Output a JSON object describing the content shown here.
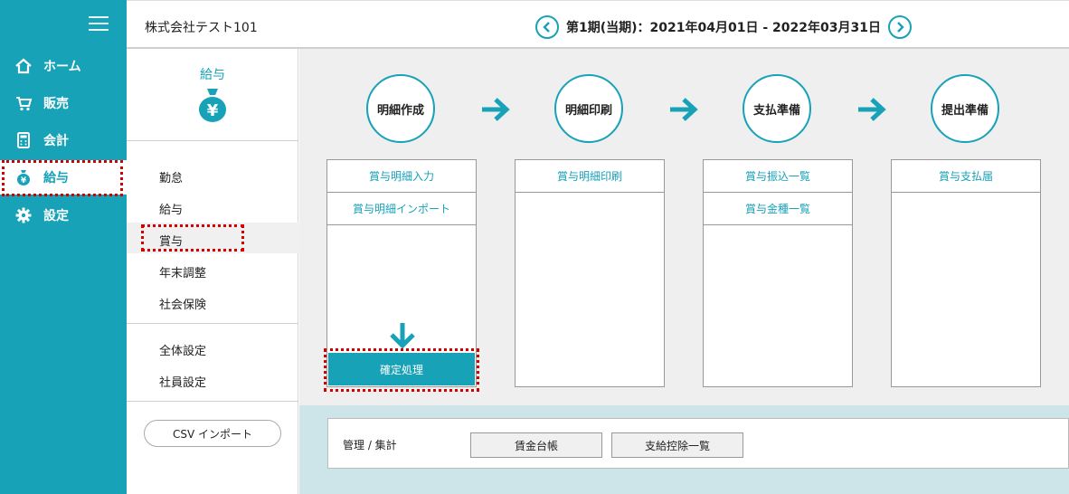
{
  "nav": {
    "items": [
      {
        "label": "ホーム",
        "icon": "home-icon"
      },
      {
        "label": "販売",
        "icon": "cart-icon"
      },
      {
        "label": "会計",
        "icon": "calculator-icon"
      },
      {
        "label": "給与",
        "icon": "money-bag-icon"
      },
      {
        "label": "設定",
        "icon": "gear-icon"
      }
    ],
    "active_index": 3
  },
  "header": {
    "company": "株式会社テスト101",
    "period": "第1期(当期)：2021年04月01日 - 2022年03月31日"
  },
  "submenu": {
    "title": "給与",
    "group1": [
      "勤怠",
      "給与",
      "賞与",
      "年末調整",
      "社会保険"
    ],
    "group2": [
      "全体設定",
      "社員設定"
    ],
    "selected": "賞与",
    "csv_button": "CSV インポート"
  },
  "steps": [
    {
      "label": "明細作成",
      "items": [
        "賞与明細入力",
        "賞与明細インポート"
      ]
    },
    {
      "label": "明細印刷",
      "items": [
        "賞与明細印刷"
      ]
    },
    {
      "label": "支払準備",
      "items": [
        "賞与振込一覧",
        "賞与金種一覧"
      ]
    },
    {
      "label": "提出準備",
      "items": [
        "賞与支払届"
      ]
    }
  ],
  "confirm_button": "確定処理",
  "summary": {
    "label": "管理 / 集計",
    "buttons": [
      "賃金台帳",
      "支給控除一覧"
    ]
  },
  "colors": {
    "accent": "#17a2b8",
    "highlight": "#d40000",
    "band": "#cde4e8"
  }
}
